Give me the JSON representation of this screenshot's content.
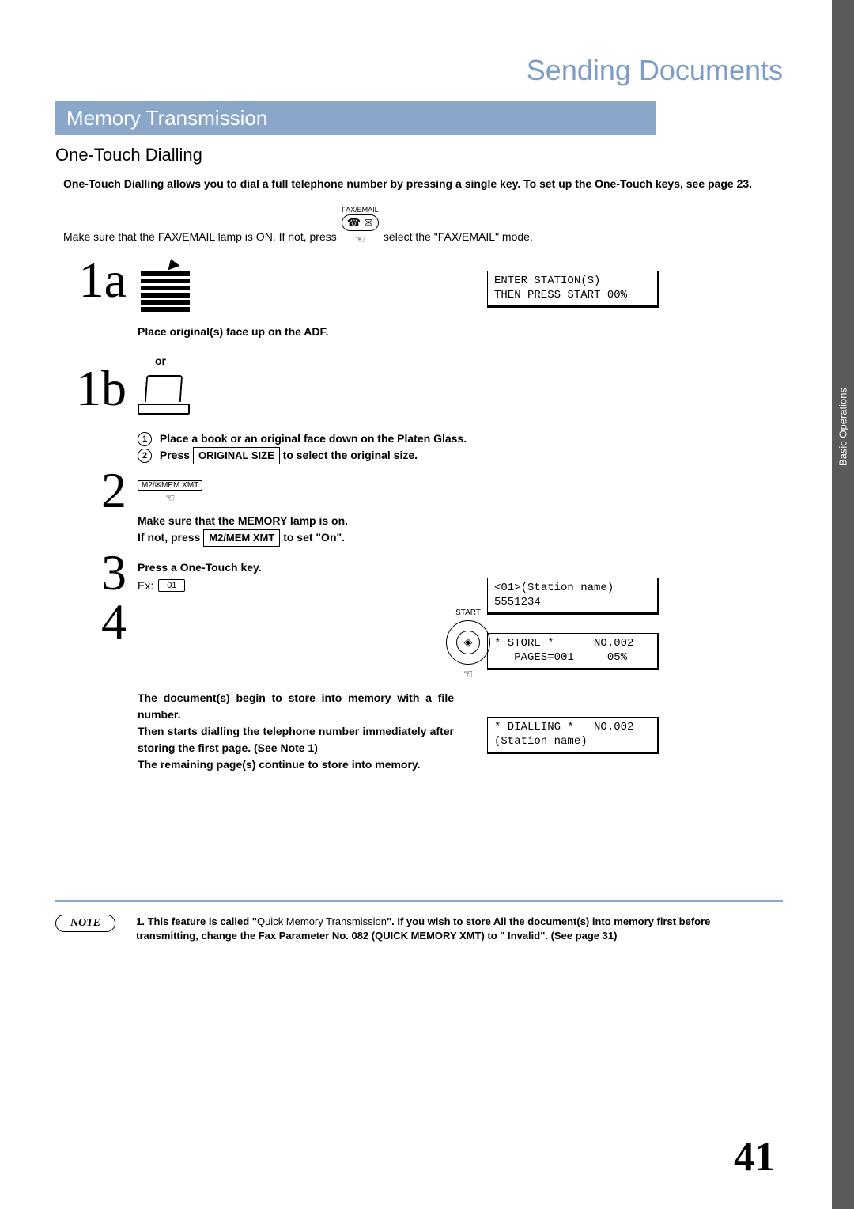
{
  "chapter": "Sending Documents",
  "sidebar_tab": "Basic Operations",
  "section_band": "Memory Transmission",
  "subsection": "One-Touch Dialling",
  "intro_bold": "One-Touch Dialling allows you to dial a full telephone number by pressing a single key. To set up the One-Touch keys, see page 23.",
  "lead_pre": "Make sure that the FAX/EMAIL lamp is ON.  If not, press",
  "faxemail_label": "FAX/EMAIL",
  "lead_post": " select the \"FAX/EMAIL\" mode.",
  "step1a_num": "1a",
  "step1a_caption": "Place original(s) face up on the ADF.",
  "or_text": "or",
  "step1b_num": "1b",
  "step1b_line1_pre": "Place a book or an original face down on the Platen Glass.",
  "step1b_line2_pre": "Press ",
  "original_size_label": "ORIGINAL  SIZE",
  "step1b_line2_post": "  to select the original size.",
  "step2_num": "2",
  "mem_key_label": "M2/✉MEM XMT",
  "step2_line1": "Make sure that the MEMORY lamp is on.",
  "step2_line2_pre": "If not, press ",
  "mem_key_boxed": "M2/MEM  XMT",
  "step2_line2_post": "  to set \"On\".",
  "step3_num": "3",
  "step3_title": "Press a One-Touch key.",
  "step3_ex_label": "Ex:",
  "step3_ex_key": "01",
  "step4_num": "4",
  "start_label": "START",
  "start_glyph": "◈",
  "step4_para": "The document(s) begin to store into memory with a file number.\nThen starts dialling the telephone number immediately after storing the first page. (See Note 1)\nThe remaining page(s) continue to store into memory.",
  "lcd1": "ENTER STATION(S)\nTHEN PRESS START 00%",
  "lcd2": "<01>(Station name)\n5551234",
  "lcd3": "* STORE *      NO.002\n   PAGES=001     05%",
  "lcd4": "* DIALLING *   NO.002\n(Station name)",
  "note_label": "NOTE",
  "note_text_pre": "1. This feature is called \"",
  "note_text_mid": "Quick Memory Transmission",
  "note_text_post": "\". If you wish to store All the document(s) into memory first before transmitting, change the Fax Parameter No. 082 (QUICK MEMORY XMT) to \" Invalid\". (See page 31)",
  "page_number": "41"
}
